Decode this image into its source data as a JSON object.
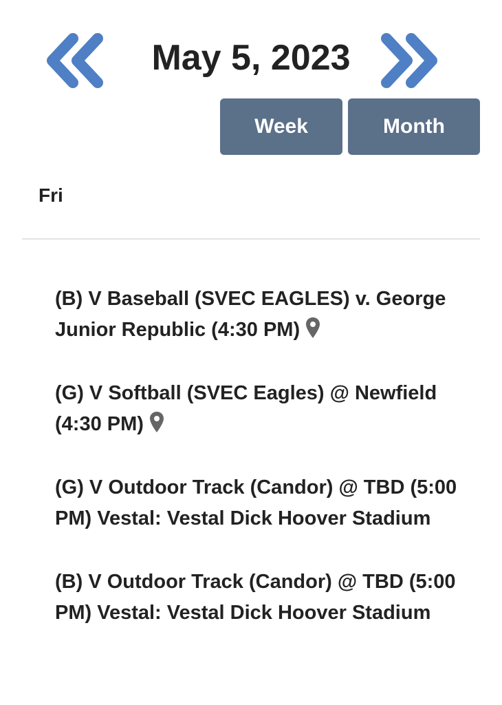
{
  "header": {
    "date_title": "May 5, 2023",
    "prev_icon": "double-chevron-left-icon",
    "next_icon": "double-chevron-right-icon"
  },
  "view_buttons": {
    "week_label": "Week",
    "month_label": "Month"
  },
  "day": {
    "label": "Fri"
  },
  "events": [
    {
      "text": "(B) V Baseball (SVEC EAGLES) v. George Junior Republic (4:30 PM)",
      "has_location_pin": true
    },
    {
      "text": "(G) V Softball (SVEC Eagles) @ Newfield (4:30 PM)",
      "has_location_pin": true
    },
    {
      "text": "(G) V Outdoor Track (Candor) @ TBD (5:00 PM) Vestal: Vestal Dick Hoover Stadium",
      "has_location_pin": false
    },
    {
      "text": "(B) V Outdoor Track (Candor) @ TBD (5:00 PM) Vestal: Vestal Dick Hoover Stadium",
      "has_location_pin": false
    }
  ],
  "colors": {
    "accent_arrow": "#4f7fc4",
    "button_bg": "#5b7089",
    "button_text": "#ffffff",
    "text": "#222222",
    "pin": "#666666",
    "divider": "#e2e2e2"
  }
}
